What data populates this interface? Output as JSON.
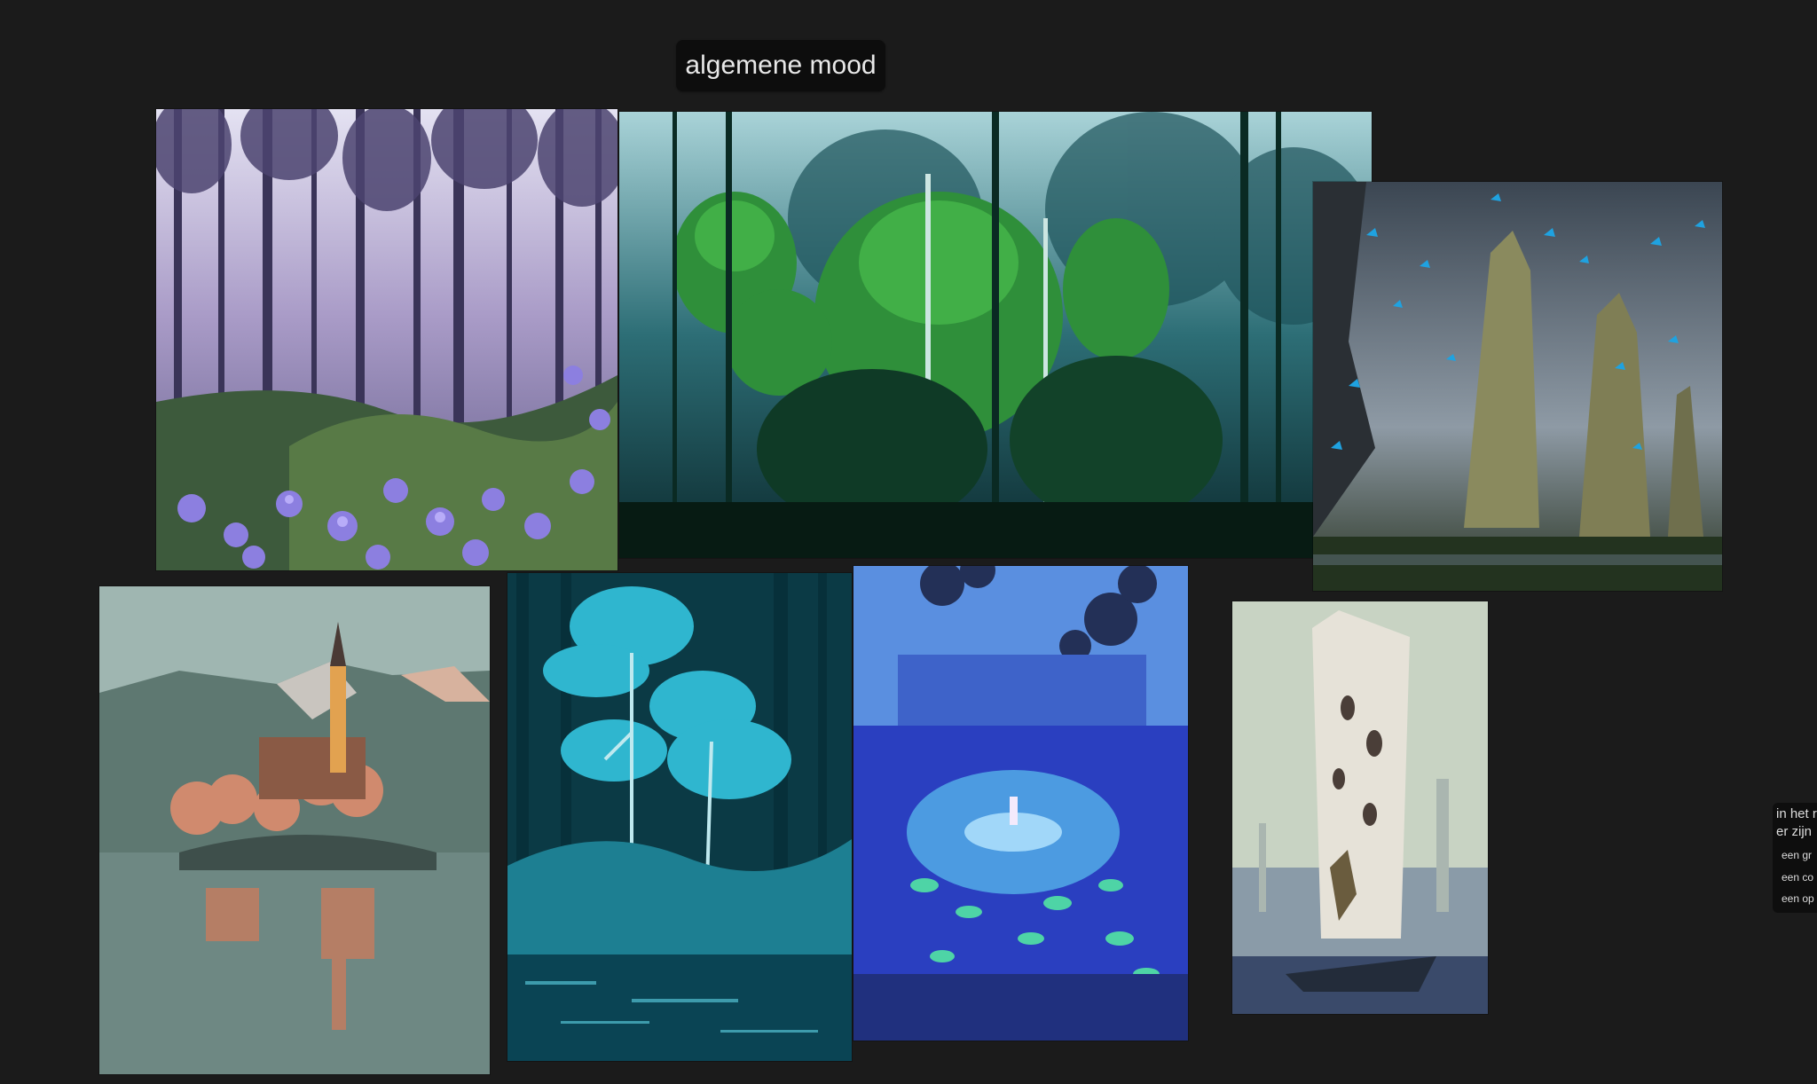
{
  "board": {
    "title": "algemene mood"
  },
  "images": [
    {
      "name": "forest-hydrangea-image",
      "subject": "purple forest with hydrangeas"
    },
    {
      "name": "green-forest-image",
      "subject": "green canopy forest"
    },
    {
      "name": "rock-pillars-butterflies-image",
      "subject": "rock pillars with blue butterflies"
    },
    {
      "name": "lake-church-island-image",
      "subject": "church on island in lake"
    },
    {
      "name": "blue-trees-image",
      "subject": "stylized blue trees by water"
    },
    {
      "name": "pond-lilypads-image",
      "subject": "figure in pond with lily pads"
    },
    {
      "name": "tree-tower-image",
      "subject": "white tree tower with figure"
    }
  ],
  "note": {
    "line1": "in het r",
    "line2": "er zijn",
    "items": [
      "een gr",
      "een co",
      "een op"
    ]
  },
  "colors": {
    "canvas": "#1b1b1b",
    "chip": "#0d0d0d",
    "text": "#e8e8e8"
  }
}
